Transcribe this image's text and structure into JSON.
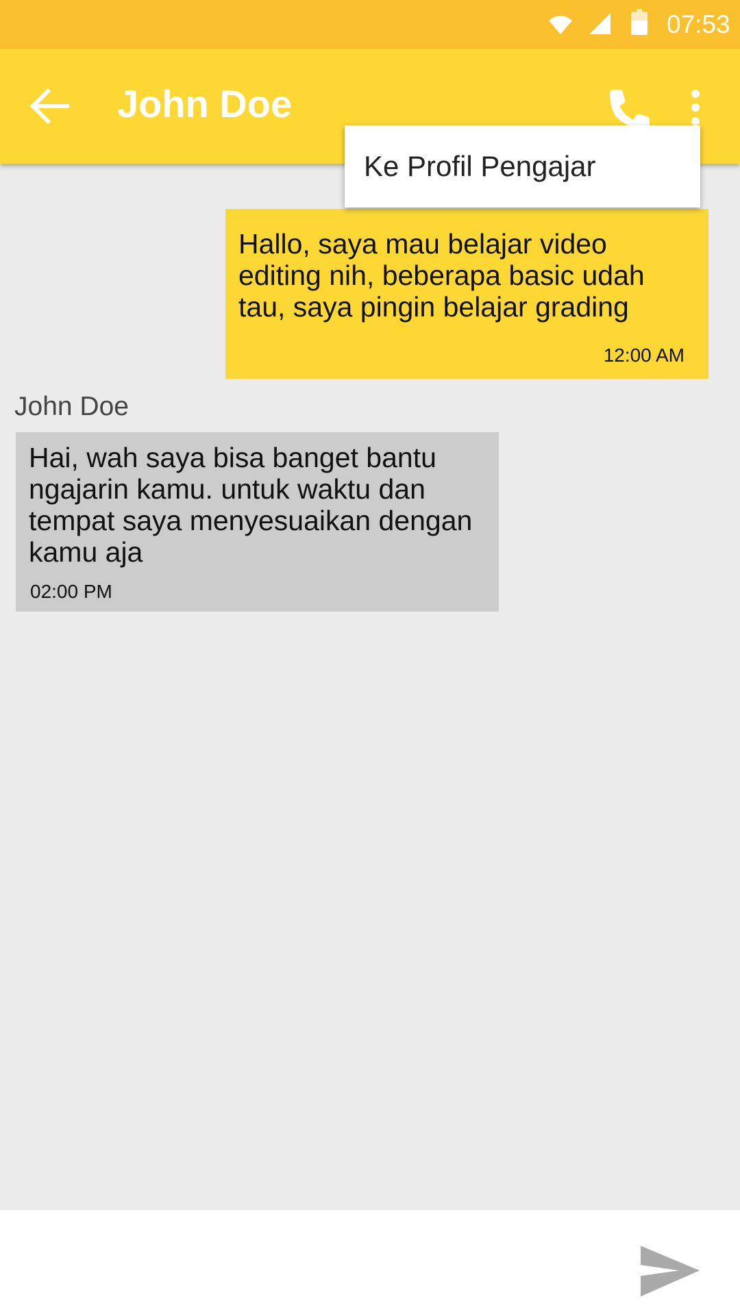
{
  "status_bar": {
    "time": "07:53",
    "icons": [
      "wifi-icon",
      "signal-icon",
      "battery-icon"
    ],
    "color": "#fbc02d"
  },
  "toolbar": {
    "title": "John Doe",
    "color": "#fdd835",
    "icons": [
      "back-arrow-icon",
      "phone-icon",
      "more-vertical-icon"
    ]
  },
  "menu": {
    "items": [
      {
        "label": "Ke Profil Pengajar"
      }
    ]
  },
  "messages": [
    {
      "direction": "outgoing",
      "text": "Hallo, saya mau belajar video editing nih, beberapa basic udah tau, saya pingin belajar grading",
      "time": "12:00 AM",
      "color": "#fdd835"
    },
    {
      "direction": "incoming",
      "sender": "John Doe",
      "text": "Hai, wah saya bisa banget bantu ngajarin kamu. untuk waktu dan tempat saya menyesuaikan dengan kamu aja",
      "time": "02:00 PM",
      "color": "#cccccc"
    }
  ],
  "composer": {
    "value": "",
    "placeholder": "",
    "send_icon": "send-icon"
  }
}
